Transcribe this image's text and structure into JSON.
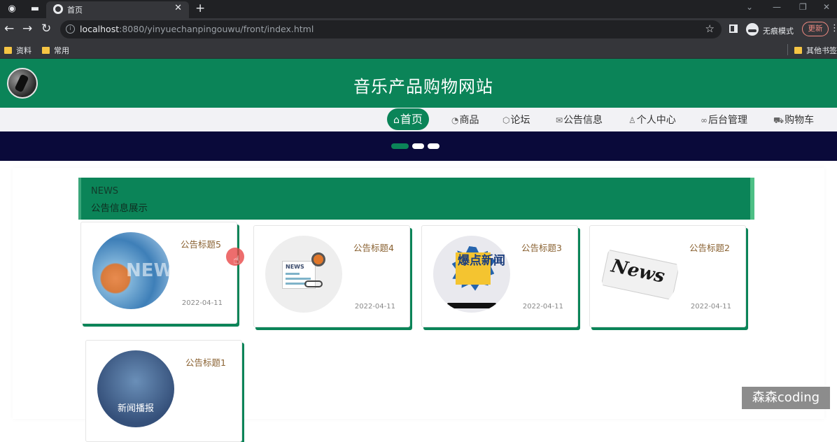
{
  "browser": {
    "tab_title": "首页",
    "url_host": "localhost",
    "url_rest": ":8080/yinyuechanpingouwu/front/index.html",
    "incognito_label": "无痕模式",
    "update_label": "更新",
    "bookmarks": [
      "资料",
      "常用"
    ],
    "other_bookmarks": "其他书签"
  },
  "site": {
    "title": "音乐产品购物网站",
    "nav": [
      {
        "icon": "home-icon",
        "label": "首页",
        "active": true
      },
      {
        "icon": "gauge-icon",
        "label": "商品"
      },
      {
        "icon": "cube-icon",
        "label": "论坛"
      },
      {
        "icon": "mail-icon",
        "label": "公告信息"
      },
      {
        "icon": "user-icon",
        "label": "个人中心"
      },
      {
        "icon": "link-icon",
        "label": "后台管理"
      },
      {
        "icon": "cart-icon",
        "label": "购物车"
      }
    ],
    "carousel": {
      "slides": 3,
      "active_index": 0
    }
  },
  "news": {
    "heading_en": "NEWS",
    "heading_cn": "公告信息展示",
    "items": [
      {
        "title": "公告标题5",
        "date": "2022-04-11",
        "image_text": "NEW"
      },
      {
        "title": "公告标题4",
        "date": "2022-04-11",
        "image_text": "NEWS"
      },
      {
        "title": "公告标题3",
        "date": "2022-04-11",
        "image_text": "爆点新闻"
      },
      {
        "title": "公告标题2",
        "date": "2022-04-11",
        "image_text": "News"
      },
      {
        "title": "公告标题1",
        "image_text": "新闻播报"
      }
    ]
  },
  "watermark": "森森coding",
  "colors": {
    "brand": "#0b8458",
    "banner": "#0a0a3a"
  }
}
